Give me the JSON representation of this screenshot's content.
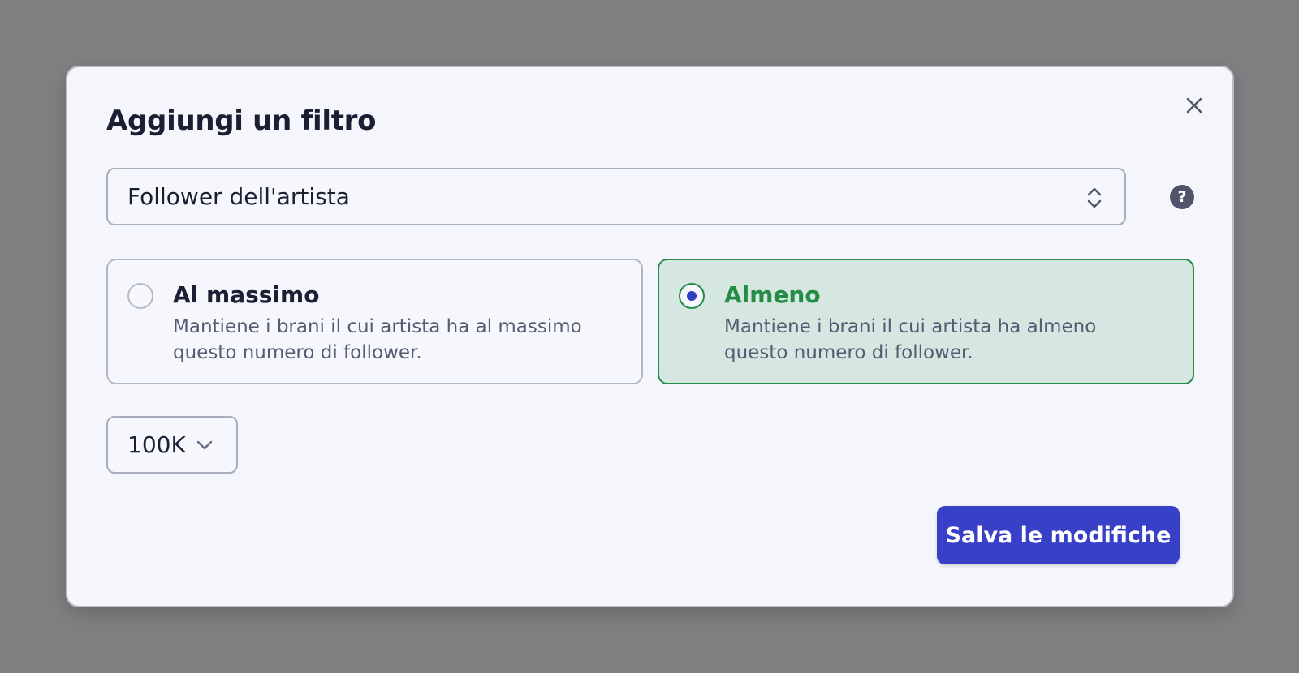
{
  "modal": {
    "title": "Aggiungi un filtro",
    "close_icon": "close-icon",
    "help_icon": "help-icon",
    "help_glyph": "?"
  },
  "filter_select": {
    "value": "Follower dell'artista",
    "icon": "chevron-up-down-icon"
  },
  "options": [
    {
      "title": "Al massimo",
      "description": "Mantiene i brani il cui artista ha al massimo questo numero di follower.",
      "selected": false
    },
    {
      "title": "Almeno",
      "description": "Mantiene i brani il cui artista ha almeno questo numero di follower.",
      "selected": true
    }
  ],
  "amount_select": {
    "value": "100K",
    "icon": "chevron-down-icon"
  },
  "actions": {
    "save_label": "Salva le modifiche"
  },
  "colors": {
    "backdrop": "#808083",
    "modal_bg": "#f4f6fb",
    "accent_green": "#238d46",
    "selected_bg": "#d6e7e2",
    "primary_button": "#3840c8",
    "radio_dot": "#3040c4"
  }
}
